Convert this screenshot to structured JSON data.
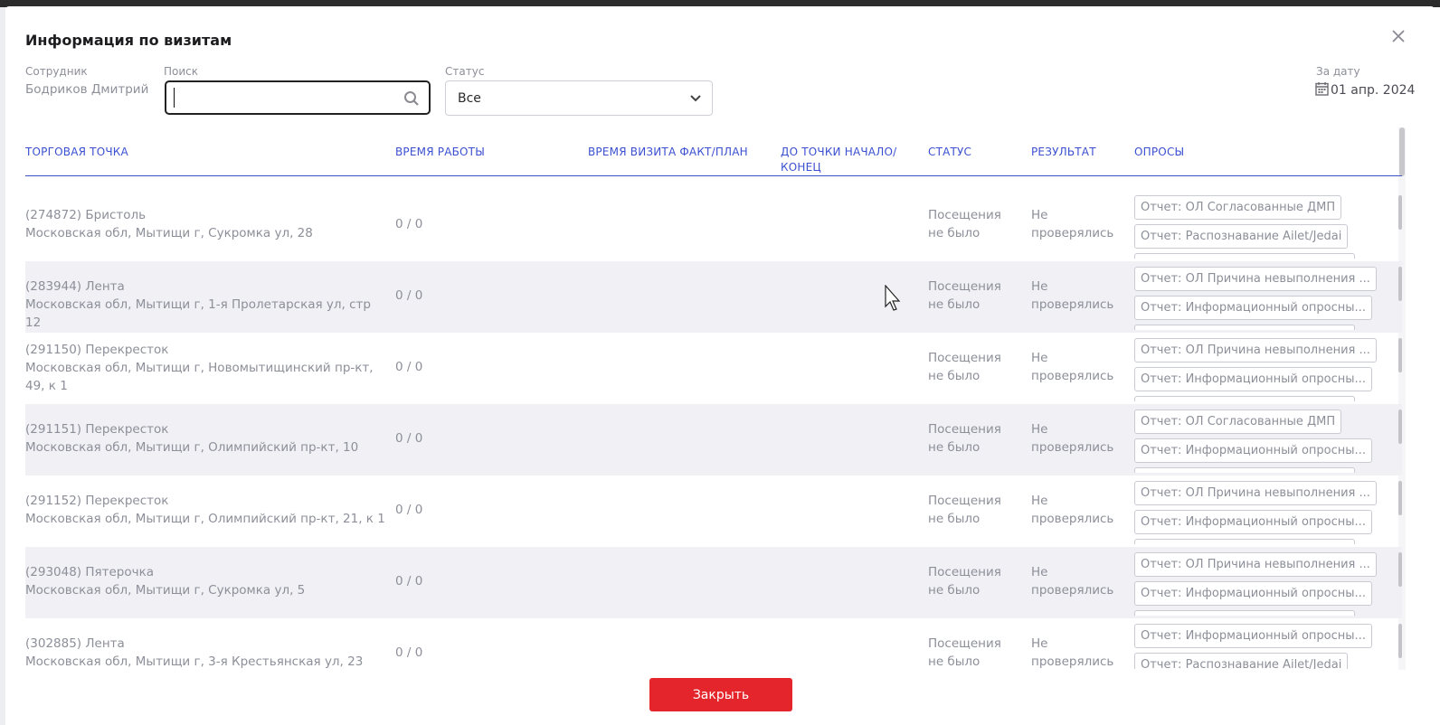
{
  "modal": {
    "title": "Информация по визитам",
    "close_button_label": "Закрыть"
  },
  "filters": {
    "employee_label": "Сотрудник",
    "employee_value": "Бодриков Дмитрий",
    "search_label": "Поиск",
    "search_value": "",
    "search_placeholder": "",
    "status_label": "Статус",
    "status_value": "Все",
    "date_label": "За дату",
    "date_value": "01 апр. 2024"
  },
  "table": {
    "headers": [
      "ТОРГОВАЯ ТОЧКА",
      "ВРЕМЯ РАБОТЫ",
      "ВРЕМЯ ВИЗИТА ФАКТ/ПЛАН",
      "ДО ТОЧКИ НАЧАЛО/ КОНЕЦ",
      "СТАТУС",
      "РЕЗУЛЬТАТ",
      "ОПРОСЫ"
    ],
    "rows": [
      {
        "name": "(274872) Бристоль",
        "address": "Московская обл, Мытищи г, Сукромка ул, 28",
        "work_time": "0 / 0",
        "status": "Посещения не было",
        "result": "Не проверялись",
        "surveys": [
          "Отчет: ОЛ Согласованные ДМП",
          "Отчет: Распознавание Ailet/Jedai"
        ]
      },
      {
        "name": "(283944) Лента",
        "address": "Московская обл, Мытищи г, 1-я Пролетарская ул, стр 12",
        "work_time": "0 / 0",
        "status": "Посещения не было",
        "result": "Не проверялись",
        "surveys": [
          "Отчет: ОЛ Причина невыполнения ...",
          "Отчет: Информационный опросны..."
        ]
      },
      {
        "name": "(291150) Перекресток",
        "address": "Московская обл, Мытищи г, Новомытищинский пр-кт, 49, к 1",
        "work_time": "0 / 0",
        "status": "Посещения не было",
        "result": "Не проверялись",
        "surveys": [
          "Отчет: ОЛ Причина невыполнения ...",
          "Отчет: Информационный опросны..."
        ]
      },
      {
        "name": "(291151) Перекресток",
        "address": "Московская обл, Мытищи г, Олимпийский пр-кт, 10",
        "work_time": "0 / 0",
        "status": "Посещения не было",
        "result": "Не проверялись",
        "surveys": [
          "Отчет: ОЛ Согласованные ДМП",
          "Отчет: Информационный опросны..."
        ]
      },
      {
        "name": "(291152) Перекресток",
        "address": "Московская обл, Мытищи г, Олимпийский пр-кт, 21, к 1",
        "work_time": "0 / 0",
        "status": "Посещения не было",
        "result": "Не проверялись",
        "surveys": [
          "Отчет: ОЛ Причина невыполнения ...",
          "Отчет: Информационный опросны..."
        ]
      },
      {
        "name": "(293048) Пятерочка",
        "address": "Московская обл, Мытищи г, Сукромка ул, 5",
        "work_time": "0 / 0",
        "status": "Посещения не было",
        "result": "Не проверялись",
        "surveys": [
          "Отчет: ОЛ Причина невыполнения ...",
          "Отчет: Информационный опросны..."
        ]
      },
      {
        "name": "(302885) Лента",
        "address": "Московская обл, Мытищи г, 3-я Крестьянская ул, 23",
        "work_time": "0 / 0",
        "status": "Посещения не было",
        "result": "Не проверялись",
        "surveys": [
          "Отчет: Информационный опросны...",
          "Отчет: Распознавание Ailet/Jedai"
        ]
      }
    ]
  },
  "icons": {
    "close": "close-icon",
    "search": "search-icon",
    "chevron": "chevron-down-icon",
    "calendar": "calendar-icon"
  },
  "colors": {
    "accent": "#3b50d0",
    "close_button": "#e4262c",
    "text_muted": "#8d8f99"
  }
}
